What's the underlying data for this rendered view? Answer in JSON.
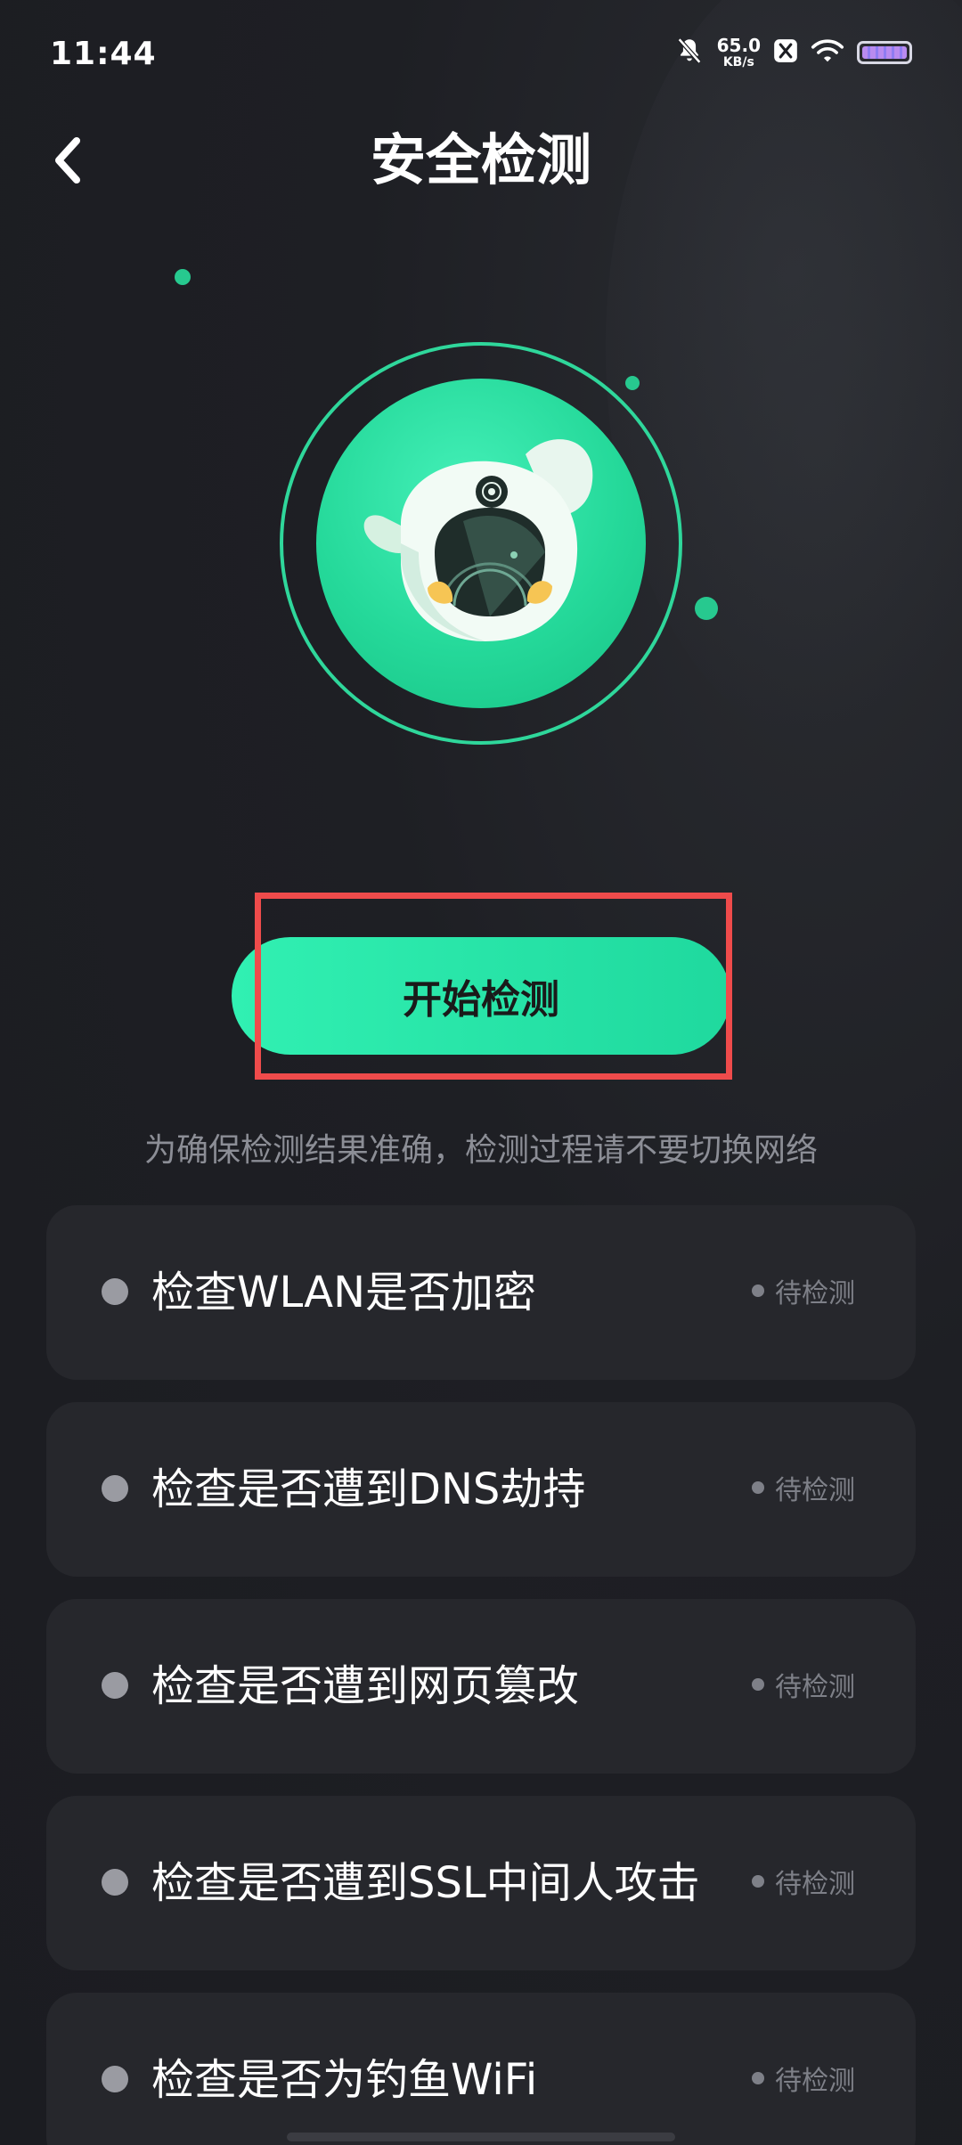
{
  "status_bar": {
    "time": "11:44",
    "net_speed_value": "65.0",
    "net_speed_unit": "KB/s",
    "icons": [
      "mute-icon",
      "network-speed",
      "x-app-icon",
      "wifi-icon",
      "battery-icon"
    ]
  },
  "header": {
    "title": "安全检测",
    "back_icon": "chevron-left-icon"
  },
  "hero": {
    "icon": "security-scan-mascot-icon",
    "accent_color": "#27c98f"
  },
  "start_button": {
    "label": "开始检测"
  },
  "hint": "为确保检测结果准确，检测过程请不要切换网络",
  "check_items": [
    {
      "label": "检查WLAN是否加密",
      "status": "待检测"
    },
    {
      "label": "检查是否遭到DNS劫持",
      "status": "待检测"
    },
    {
      "label": "检查是否遭到网页篡改",
      "status": "待检测"
    },
    {
      "label": "检查是否遭到SSL中间人攻击",
      "status": "待检测"
    },
    {
      "label": "检查是否为钓鱼WiFi",
      "status": "待检测"
    }
  ],
  "colors": {
    "background": "#1c1d22",
    "card": "#26272c",
    "accent": "#27c98f",
    "highlight": "#ef4b4b"
  }
}
